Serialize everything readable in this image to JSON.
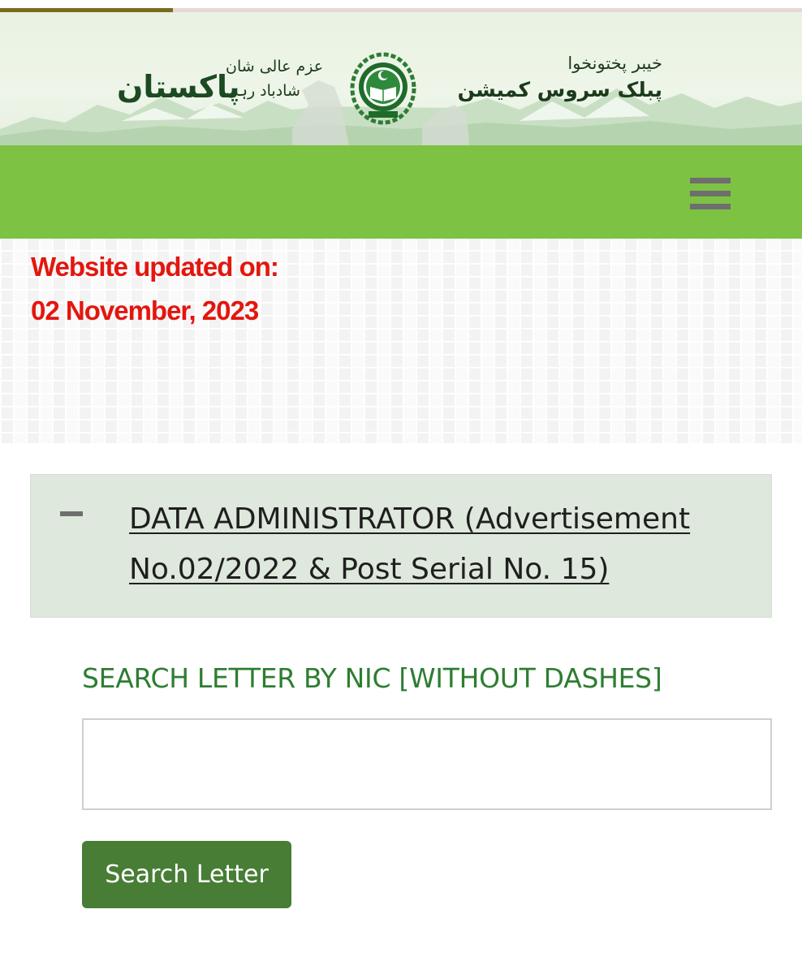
{
  "progress": {
    "fraction": 0.216,
    "fill_color": "#7a6a1c",
    "track_color": "#e6d8d4"
  },
  "header": {
    "slogan_top": "عزم عالی شان",
    "slogan_bottom": "شادباد رہی",
    "slogan_main": "پاکستان",
    "org_line1": "خیبر پختونخوا",
    "org_line2": "پبلک سروس کمیشن",
    "emblem_icon": "kppsc-emblem-icon"
  },
  "nav": {
    "menu_icon": "hamburger-menu-icon",
    "bar_color": "#7dc242"
  },
  "notice": {
    "line1": "Website updated on:",
    "line2": "02 November, 2023",
    "color": "#e3160e"
  },
  "accordion": {
    "toggle_icon": "minus-icon",
    "title": "DATA ADMINISTRATOR (Advertisement No.02/2022 & Post Serial No. 15)"
  },
  "search": {
    "label": "SEARCH LETTER BY NIC [WITHOUT DASHES]",
    "value": "",
    "placeholder": "",
    "button_label": "Search Letter",
    "button_color": "#477d35"
  }
}
